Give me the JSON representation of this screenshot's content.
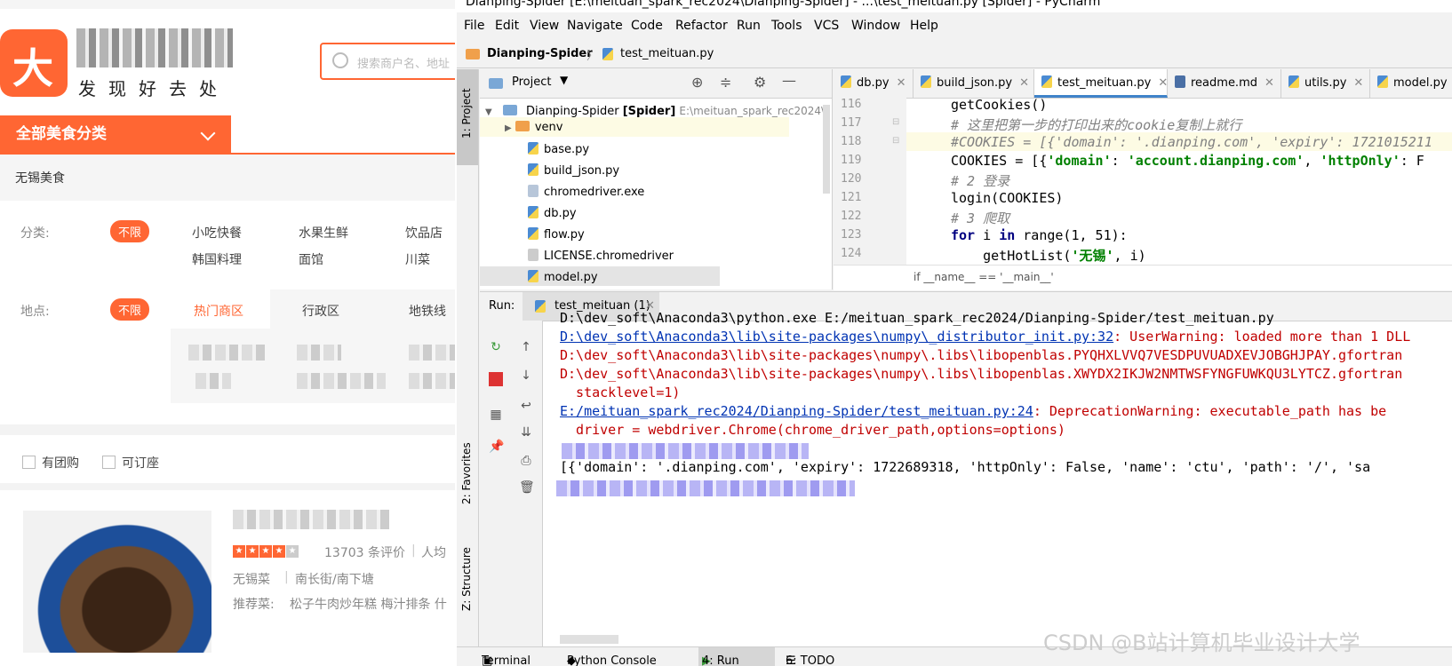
{
  "web": {
    "slogan": "发现好去处",
    "search_placeholder": "搜索商户名、地址",
    "category_button": "全部美食分类",
    "city_food": "无锡美食",
    "filters": {
      "category_label": "分类:",
      "category_tag": "不限",
      "categories": [
        "小吃快餐",
        "水果生鲜",
        "饮品店",
        "韩国料理",
        "面馆",
        "川菜"
      ],
      "location_label": "地点:",
      "location_tag": "不限",
      "location_tabs": [
        "热门商区",
        "行政区",
        "地铁线"
      ]
    },
    "checkboxes": [
      "有团购",
      "可订座"
    ],
    "listing": {
      "reviews": "13703 条评价",
      "avg": "人均",
      "cuisine": "无锡菜",
      "area": "南长街/南下塘",
      "recommend_label": "推荐菜:",
      "recommend": "松子牛肉炒年糕 梅汁排条 什",
      "rating_stars": 4
    }
  },
  "ide": {
    "title": "Dianping-Spider [E:\\meituan_spark_rec2024\\Dianping-Spider] - ...\\test_meituan.py [Spider] - PyCharm",
    "menu": [
      "File",
      "Edit",
      "View",
      "Navigate",
      "Code",
      "Refactor",
      "Run",
      "Tools",
      "VCS",
      "Window",
      "Help"
    ],
    "breadcrumb": [
      "Dianping-Spider",
      "test_meituan.py"
    ],
    "left_tabs": [
      "1: Project",
      "2: Favorites",
      "Z: Structure"
    ],
    "project": {
      "header": "Project",
      "root": "Dianping-Spider",
      "root_tag": "[Spider]",
      "root_path": "E:\\meituan_spark_rec2024\\",
      "items": [
        "venv",
        "base.py",
        "build_json.py",
        "chromedriver.exe",
        "db.py",
        "flow.py",
        "LICENSE.chromedriver",
        "model.py"
      ]
    },
    "tabs": [
      "db.py",
      "build_json.py",
      "test_meituan.py",
      "readme.md",
      "utils.py",
      "model.py"
    ],
    "code": {
      "line_numbers": [
        "116",
        "117",
        "118",
        "119",
        "120",
        "121",
        "122",
        "123",
        "124"
      ],
      "l116": "getCookies()",
      "l117": "# 这里把第一步的打印出来的cookie复制上就行",
      "l118": "#COOKIES = [{'domain': '.dianping.com', 'expiry': 1721015211",
      "l119_a": "COOKIES = [{",
      "l119_b": "'domain'",
      "l119_c": ": ",
      "l119_d": "'account.dianping.com'",
      "l119_e": ", ",
      "l119_f": "'httpOnly'",
      "l119_g": ": F",
      "l120": "# 2 登录",
      "l121": "login(COOKIES)",
      "l122": "# 3 爬取",
      "l123_a": "for",
      "l123_b": " i ",
      "l123_c": "in",
      "l123_d": " range(1, 51):",
      "l124_a": "    getHotList(",
      "l124_b": "'无锡'",
      "l124_c": ", i)",
      "crumb": "if __name__ == '__main__'"
    },
    "run": {
      "label": "Run:",
      "tab": "test_meituan (1)",
      "out1": "D:\\dev_soft\\Anaconda3\\python.exe E:/meituan_spark_rec2024/Dianping-Spider/test_meituan.py",
      "out2_link": "D:\\dev_soft\\Anaconda3\\lib\\site-packages\\numpy\\_distributor_init.py:32",
      "out2_rest": ": UserWarning: loaded more than 1 DLL",
      "out3": "D:\\dev_soft\\Anaconda3\\lib\\site-packages\\numpy\\.libs\\libopenblas.PYQHXLVVQ7VESDPUVUADXEVJOBGHJPAY.gfortran",
      "out4": "D:\\dev_soft\\Anaconda3\\lib\\site-packages\\numpy\\.libs\\libopenblas.XWYDX2IKJW2NMTWSFYNGFUWKQU3LYTCZ.gfortran",
      "out5": "  stacklevel=1)",
      "out6_link": "E:/meituan_spark_rec2024/Dianping-Spider/test_meituan.py:24",
      "out6_rest": ": DeprecationWarning: executable_path has be",
      "out7": "  driver = webdriver.Chrome(chrome_driver_path,options=options)",
      "out8": "[{'domain': '.dianping.com', 'expiry': 1722689318, 'httpOnly': False, 'name': 'ctu', 'path': '/', 'sa"
    },
    "bottom_tabs": [
      "Terminal",
      "Python Console",
      "4: Run",
      "6: TODO"
    ]
  },
  "watermark": "CSDN @B站计算机毕业设计大学"
}
